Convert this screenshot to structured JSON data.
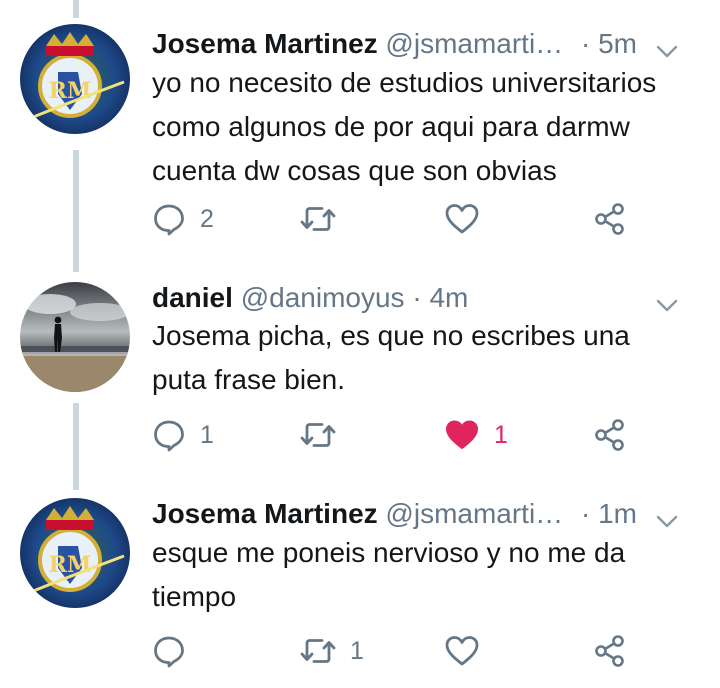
{
  "tweets": [
    {
      "name": "Josema Martinez",
      "handle": "@jsmamarti…",
      "separator": "·",
      "time": "5m",
      "text_lines": [
        "yo no necesito de estudios universitarios",
        "como algunos de por aqui para darmw",
        "cuenta dw cosas que son obvias"
      ],
      "reply_count": "2",
      "retweet_count": "",
      "like_count": "",
      "liked": false,
      "avatar": "real-madrid-crest-icon"
    },
    {
      "name": "daniel",
      "handle": "@danimoyus",
      "separator": "·",
      "time": "4m",
      "text_lines": [
        "Josema picha, es que no escribes una",
        "puta frase bien."
      ],
      "reply_count": "1",
      "retweet_count": "",
      "like_count": "1",
      "liked": true,
      "avatar": "beach-silhouette-photo"
    },
    {
      "name": "Josema Martinez",
      "handle": "@jsmamarti…",
      "separator": "·",
      "time": "1m",
      "text_lines": [
        "esque me poneis nervioso y no me da",
        "tiempo"
      ],
      "reply_count": "",
      "retweet_count": "1",
      "like_count": "",
      "liked": false,
      "avatar": "real-madrid-crest-icon"
    }
  ],
  "colors": {
    "text": "#14171a",
    "secondary": "#657786",
    "like_active": "#e0245e",
    "thread_line": "#ccd6dd"
  }
}
